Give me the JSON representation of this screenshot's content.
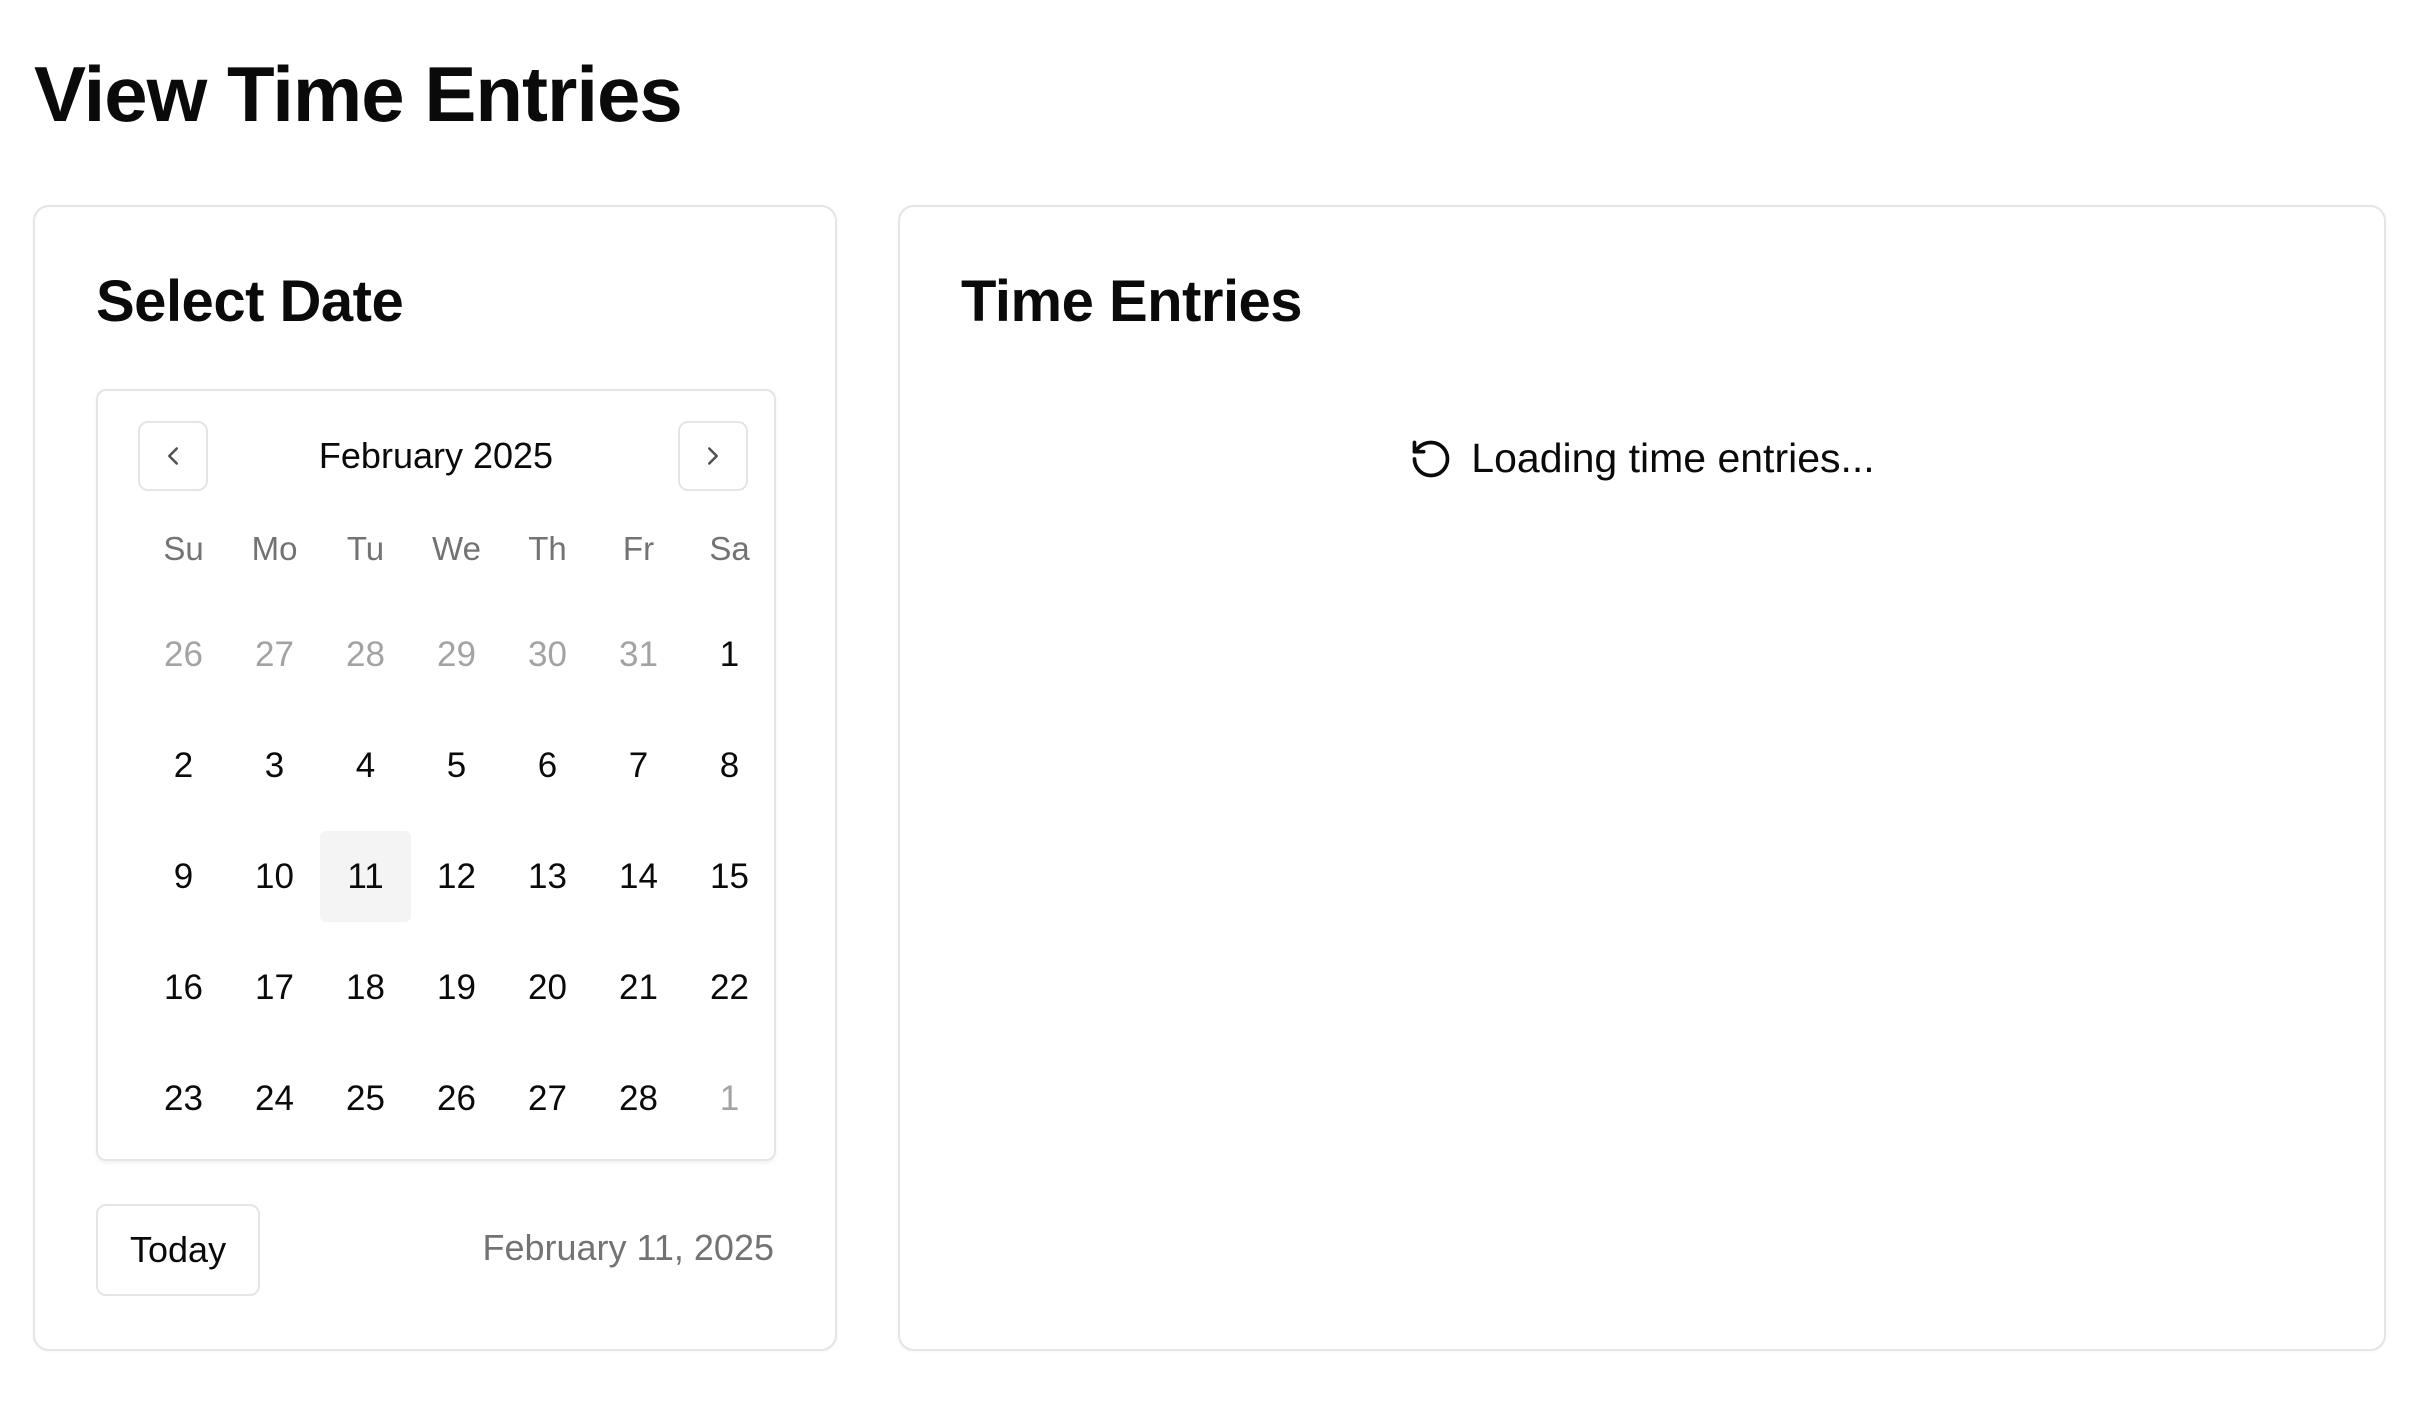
{
  "page": {
    "title": "View Time Entries"
  },
  "date_panel": {
    "title": "Select Date",
    "calendar": {
      "month_label": "February 2025",
      "weekdays": [
        "Su",
        "Mo",
        "Tu",
        "We",
        "Th",
        "Fr",
        "Sa"
      ],
      "weeks": [
        [
          {
            "d": "26",
            "outside": true
          },
          {
            "d": "27",
            "outside": true
          },
          {
            "d": "28",
            "outside": true
          },
          {
            "d": "29",
            "outside": true
          },
          {
            "d": "30",
            "outside": true
          },
          {
            "d": "31",
            "outside": true
          },
          {
            "d": "1"
          }
        ],
        [
          {
            "d": "2"
          },
          {
            "d": "3"
          },
          {
            "d": "4"
          },
          {
            "d": "5"
          },
          {
            "d": "6"
          },
          {
            "d": "7"
          },
          {
            "d": "8"
          }
        ],
        [
          {
            "d": "9"
          },
          {
            "d": "10"
          },
          {
            "d": "11",
            "selected": true
          },
          {
            "d": "12"
          },
          {
            "d": "13"
          },
          {
            "d": "14"
          },
          {
            "d": "15"
          }
        ],
        [
          {
            "d": "16"
          },
          {
            "d": "17"
          },
          {
            "d": "18"
          },
          {
            "d": "19"
          },
          {
            "d": "20"
          },
          {
            "d": "21"
          },
          {
            "d": "22"
          }
        ],
        [
          {
            "d": "23"
          },
          {
            "d": "24"
          },
          {
            "d": "25"
          },
          {
            "d": "26"
          },
          {
            "d": "27"
          },
          {
            "d": "28"
          },
          {
            "d": "1",
            "outside": true
          }
        ]
      ],
      "prev_icon": "chevron-left-icon",
      "next_icon": "chevron-right-icon"
    },
    "today_button": "Today",
    "selected_date_text": "February 11, 2025"
  },
  "entries_panel": {
    "title": "Time Entries",
    "loading_text": "Loading time entries...",
    "loading_icon": "refresh-spinner-icon"
  }
}
